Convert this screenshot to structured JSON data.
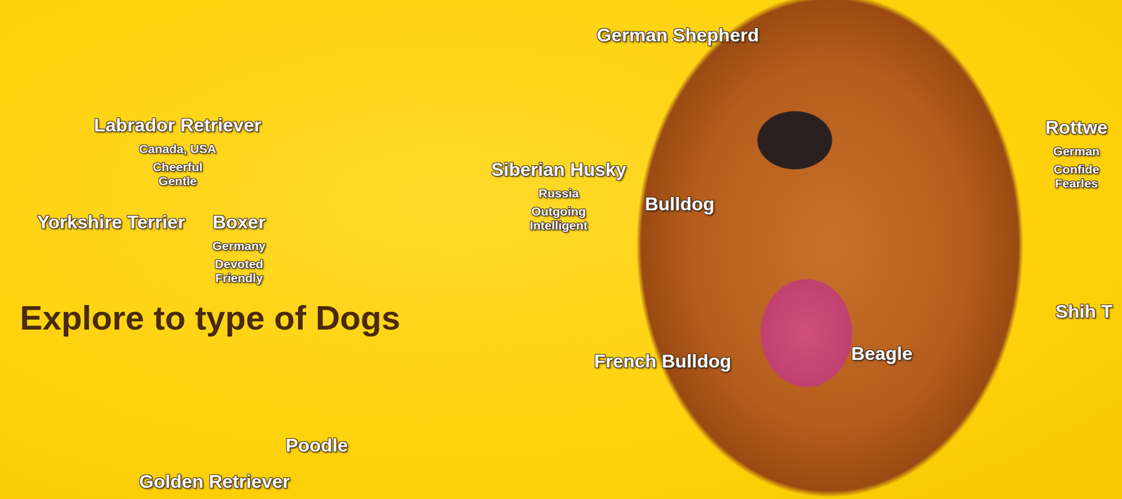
{
  "heading": "Explore to type of Dogs",
  "breeds": [
    {
      "name": "German Shepherd",
      "origin": "",
      "traits": []
    },
    {
      "name": "Labrador Retriever",
      "origin": "Canada, USA",
      "traits": [
        "Cheerful",
        "Gentle"
      ]
    },
    {
      "name": "Rottwe",
      "origin": "German",
      "traits": [
        "Confide",
        "Fearles"
      ]
    },
    {
      "name": "Siberian Husky",
      "origin": "Russia",
      "traits": [
        "Outgoing",
        "Intelligent"
      ]
    },
    {
      "name": "Bulldog",
      "origin": "",
      "traits": []
    },
    {
      "name": "Yorkshire Terrier",
      "origin": "",
      "traits": []
    },
    {
      "name": "Boxer",
      "origin": "Germany",
      "traits": [
        "Devoted",
        "Friendly"
      ]
    },
    {
      "name": "Shih T",
      "origin": "",
      "traits": []
    },
    {
      "name": "French Bulldog",
      "origin": "",
      "traits": []
    },
    {
      "name": "Beagle",
      "origin": "",
      "traits": []
    },
    {
      "name": "Poodle",
      "origin": "",
      "traits": []
    },
    {
      "name": "Golden Retriever",
      "origin": "",
      "traits": []
    }
  ]
}
